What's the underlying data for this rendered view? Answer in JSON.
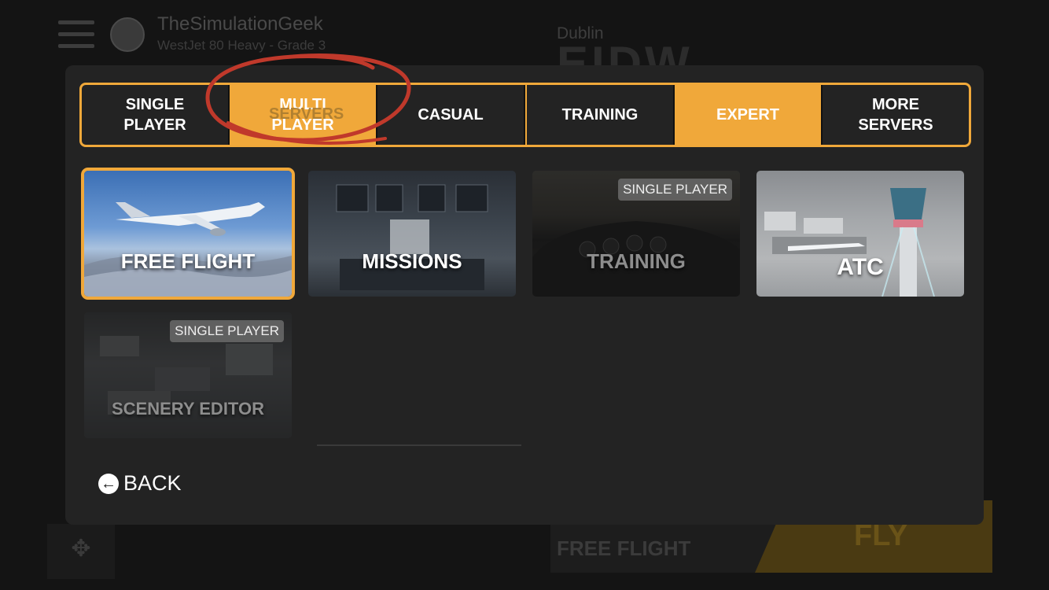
{
  "background": {
    "user_name": "TheSimulationGeek",
    "aircraft": "WestJet 80 Heavy - Grade 3",
    "airport_city": "Dublin",
    "airport_code": "EIDW",
    "bottom_mode": "FREE FLIGHT",
    "fly_label": "FLY"
  },
  "tabs": [
    {
      "label_line1": "SINGLE",
      "label_line2": "PLAYER",
      "active": false
    },
    {
      "label_line1": "MULTI",
      "label_line2": "PLAYER",
      "overlay": "SERVERS",
      "active": true
    },
    {
      "label_line1": "CASUAL",
      "label_line2": "",
      "active": false
    },
    {
      "label_line1": "TRAINING",
      "label_line2": "",
      "active": false
    },
    {
      "label_line1": "EXPERT",
      "label_line2": "",
      "active": true
    },
    {
      "label_line1": "MORE",
      "label_line2": "SERVERS",
      "active": false
    }
  ],
  "modes": [
    {
      "label": "FREE FLIGHT",
      "badge": "",
      "selected": true
    },
    {
      "label": "MISSIONS",
      "badge": "",
      "selected": false
    },
    {
      "label": "TRAINING",
      "badge": "SINGLE PLAYER",
      "selected": false
    },
    {
      "label": "ATC",
      "badge": "",
      "selected": false
    },
    {
      "label": "SCENERY EDITOR",
      "badge": "SINGLE PLAYER",
      "selected": false
    }
  ],
  "back_label": "BACK",
  "colors": {
    "accent": "#f0a83a",
    "modal_bg": "#232323",
    "annotation": "#c0392b"
  }
}
